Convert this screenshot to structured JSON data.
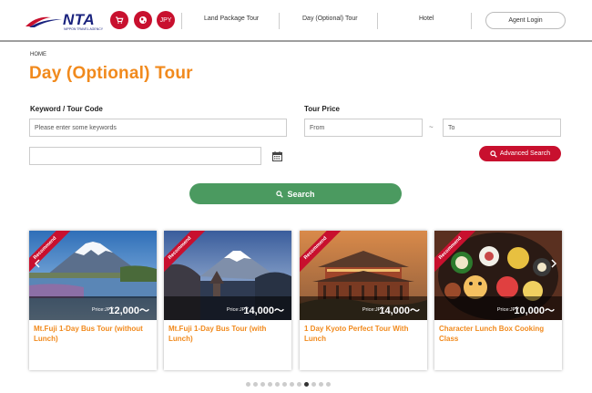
{
  "header": {
    "logo_text": "NTA",
    "logo_sub": "NIPPON TRAVEL AGENCY",
    "currency": "JPY",
    "nav": [
      "Land Package Tour",
      "Day (Optional) Tour",
      "Hotel"
    ],
    "agent_login": "Agent Login"
  },
  "breadcrumb": "HOME",
  "page_title": "Day (Optional) Tour",
  "search": {
    "keyword_label": "Keyword / Tour Code",
    "keyword_placeholder": "Please enter some keywords",
    "price_label": "Tour Price",
    "from_placeholder": "From",
    "to_placeholder": "To",
    "tilde": "~",
    "advanced_label": "Advanced Search",
    "search_label": "Search"
  },
  "cards": [
    {
      "ribbon": "Recommend",
      "price_label": "Price:JPY",
      "price": "12,000～",
      "title": "Mt.Fuji 1-Day Bus Tour (without Lunch)"
    },
    {
      "ribbon": "Recommend",
      "price_label": "Price:JPY",
      "price": "14,000～",
      "title": "Mt.Fuji 1-Day Bus Tour (with Lunch)"
    },
    {
      "ribbon": "Recommend",
      "price_label": "Price:JPY",
      "price": "14,000～",
      "title": "1 Day Kyoto Perfect Tour With Lunch"
    },
    {
      "ribbon": "Recommend",
      "price_label": "Price:JPY",
      "price": "10,000～",
      "title": "Character Lunch Box Cooking Class"
    }
  ],
  "carousel": {
    "dot_count": 12,
    "active_index": 8
  },
  "colors": {
    "brand_red": "#c8102e",
    "orange": "#f18a1d",
    "green": "#4b9a60"
  }
}
